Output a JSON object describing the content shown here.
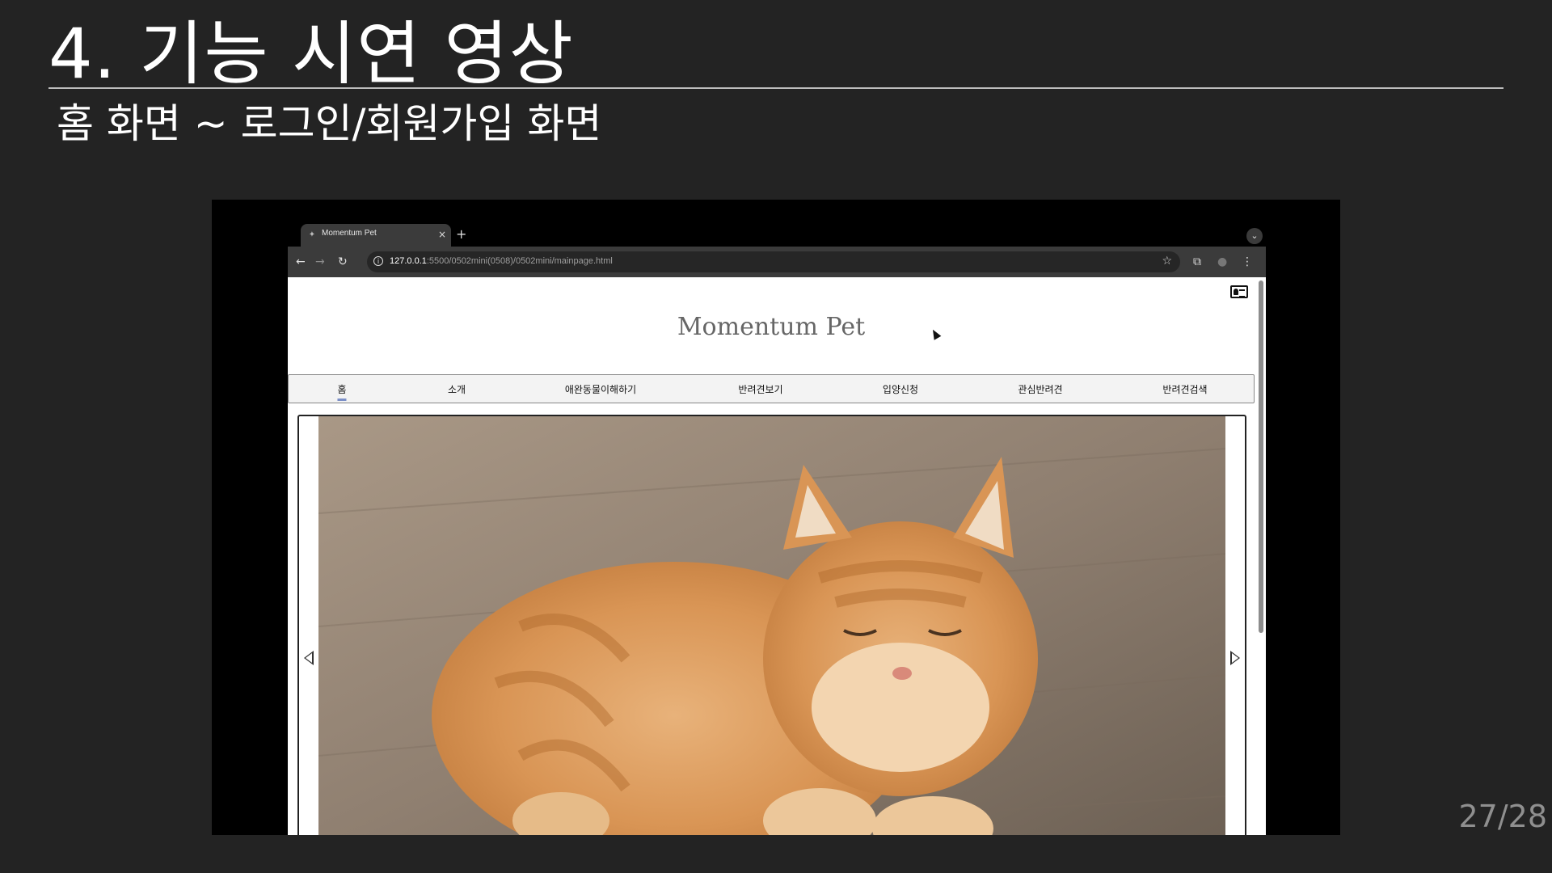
{
  "slide": {
    "title": "4. 기능 시연 영상",
    "subtitle": "홈 화면 ~ 로그인/회원가입 화면",
    "page_number": "27/28"
  },
  "browser": {
    "tab_title": "Momentum Pet",
    "tab_close": "×",
    "new_tab": "+",
    "tab_list": "⌄",
    "back": "←",
    "forward": "→",
    "reload": "↻",
    "info": "i",
    "url_host": "127.0.0.1",
    "url_path": ":5500/0502mini(0508)/0502mini/mainpage.html",
    "bookmark": "☆",
    "extensions": "⧉",
    "profile": "●",
    "menu": "⋮"
  },
  "site": {
    "logo": "Momentum Pet",
    "nav": [
      "홈",
      "소개",
      "애완동물이해하기",
      "반려견보기",
      "입양신청",
      "관심반려견",
      "반려견검색"
    ],
    "active_nav_index": 0,
    "slide_image_alt": "orange tabby cat"
  },
  "colors": {
    "slide_bg": "#232323",
    "nav_active_underline": "#7b8fc7",
    "logo_color": "#666666"
  }
}
